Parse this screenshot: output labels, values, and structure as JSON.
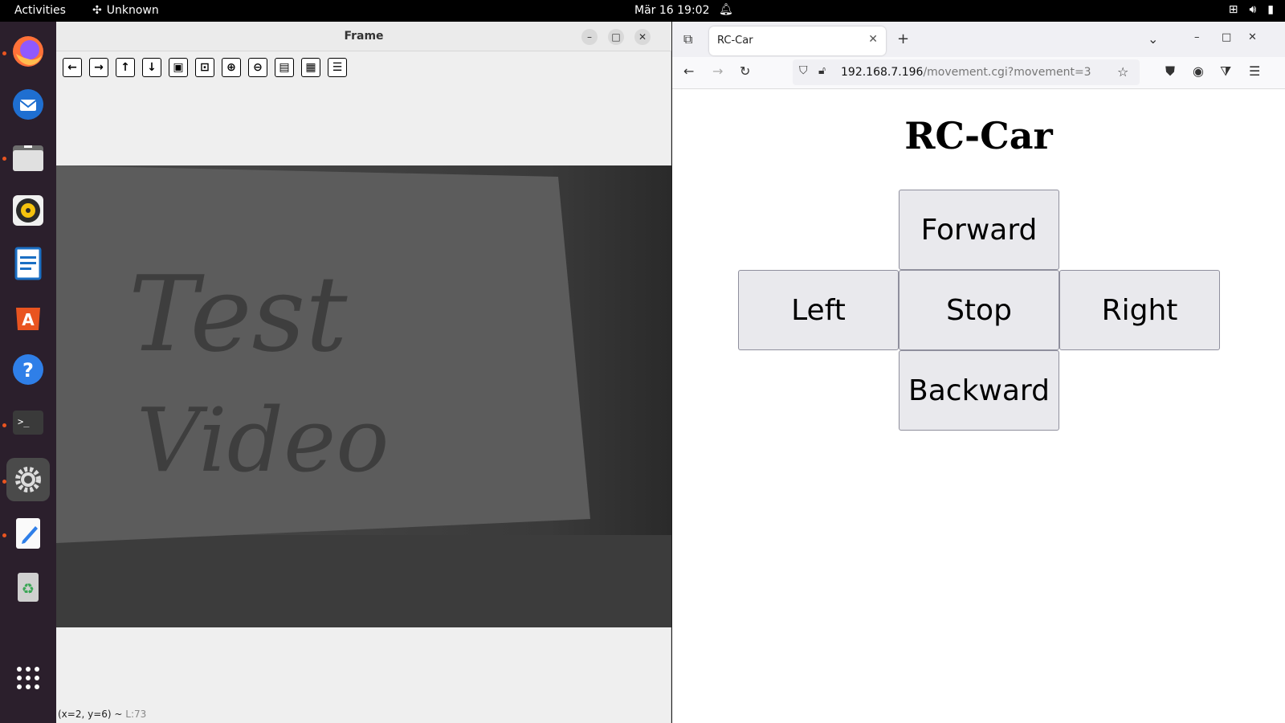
{
  "topbar": {
    "activities": "Activities",
    "app_name": "Unknown",
    "clock": "Mär 16  19:02"
  },
  "dock": {
    "apps": [
      "firefox-icon",
      "thunderbird-icon",
      "files-icon",
      "rhythmbox-icon",
      "libreoffice-writer-icon",
      "app-center-icon",
      "help-icon",
      "terminal-icon",
      "settings-icon",
      "text-editor-icon",
      "trash-icon",
      "show-apps-icon"
    ]
  },
  "frame_window": {
    "title": "Frame",
    "status_coords": "(x=2, y=6) ~",
    "status_value": "L:73",
    "video_text_line1": "Test",
    "video_text_line2": "Video"
  },
  "browser": {
    "tab_title": "RC-Car",
    "url_host": "192.168.7.196",
    "url_path": "/movement.cgi?movement=3"
  },
  "page": {
    "heading": "RC-Car",
    "buttons": {
      "forward": "Forward",
      "left": "Left",
      "stop": "Stop",
      "right": "Right",
      "backward": "Backward"
    }
  }
}
